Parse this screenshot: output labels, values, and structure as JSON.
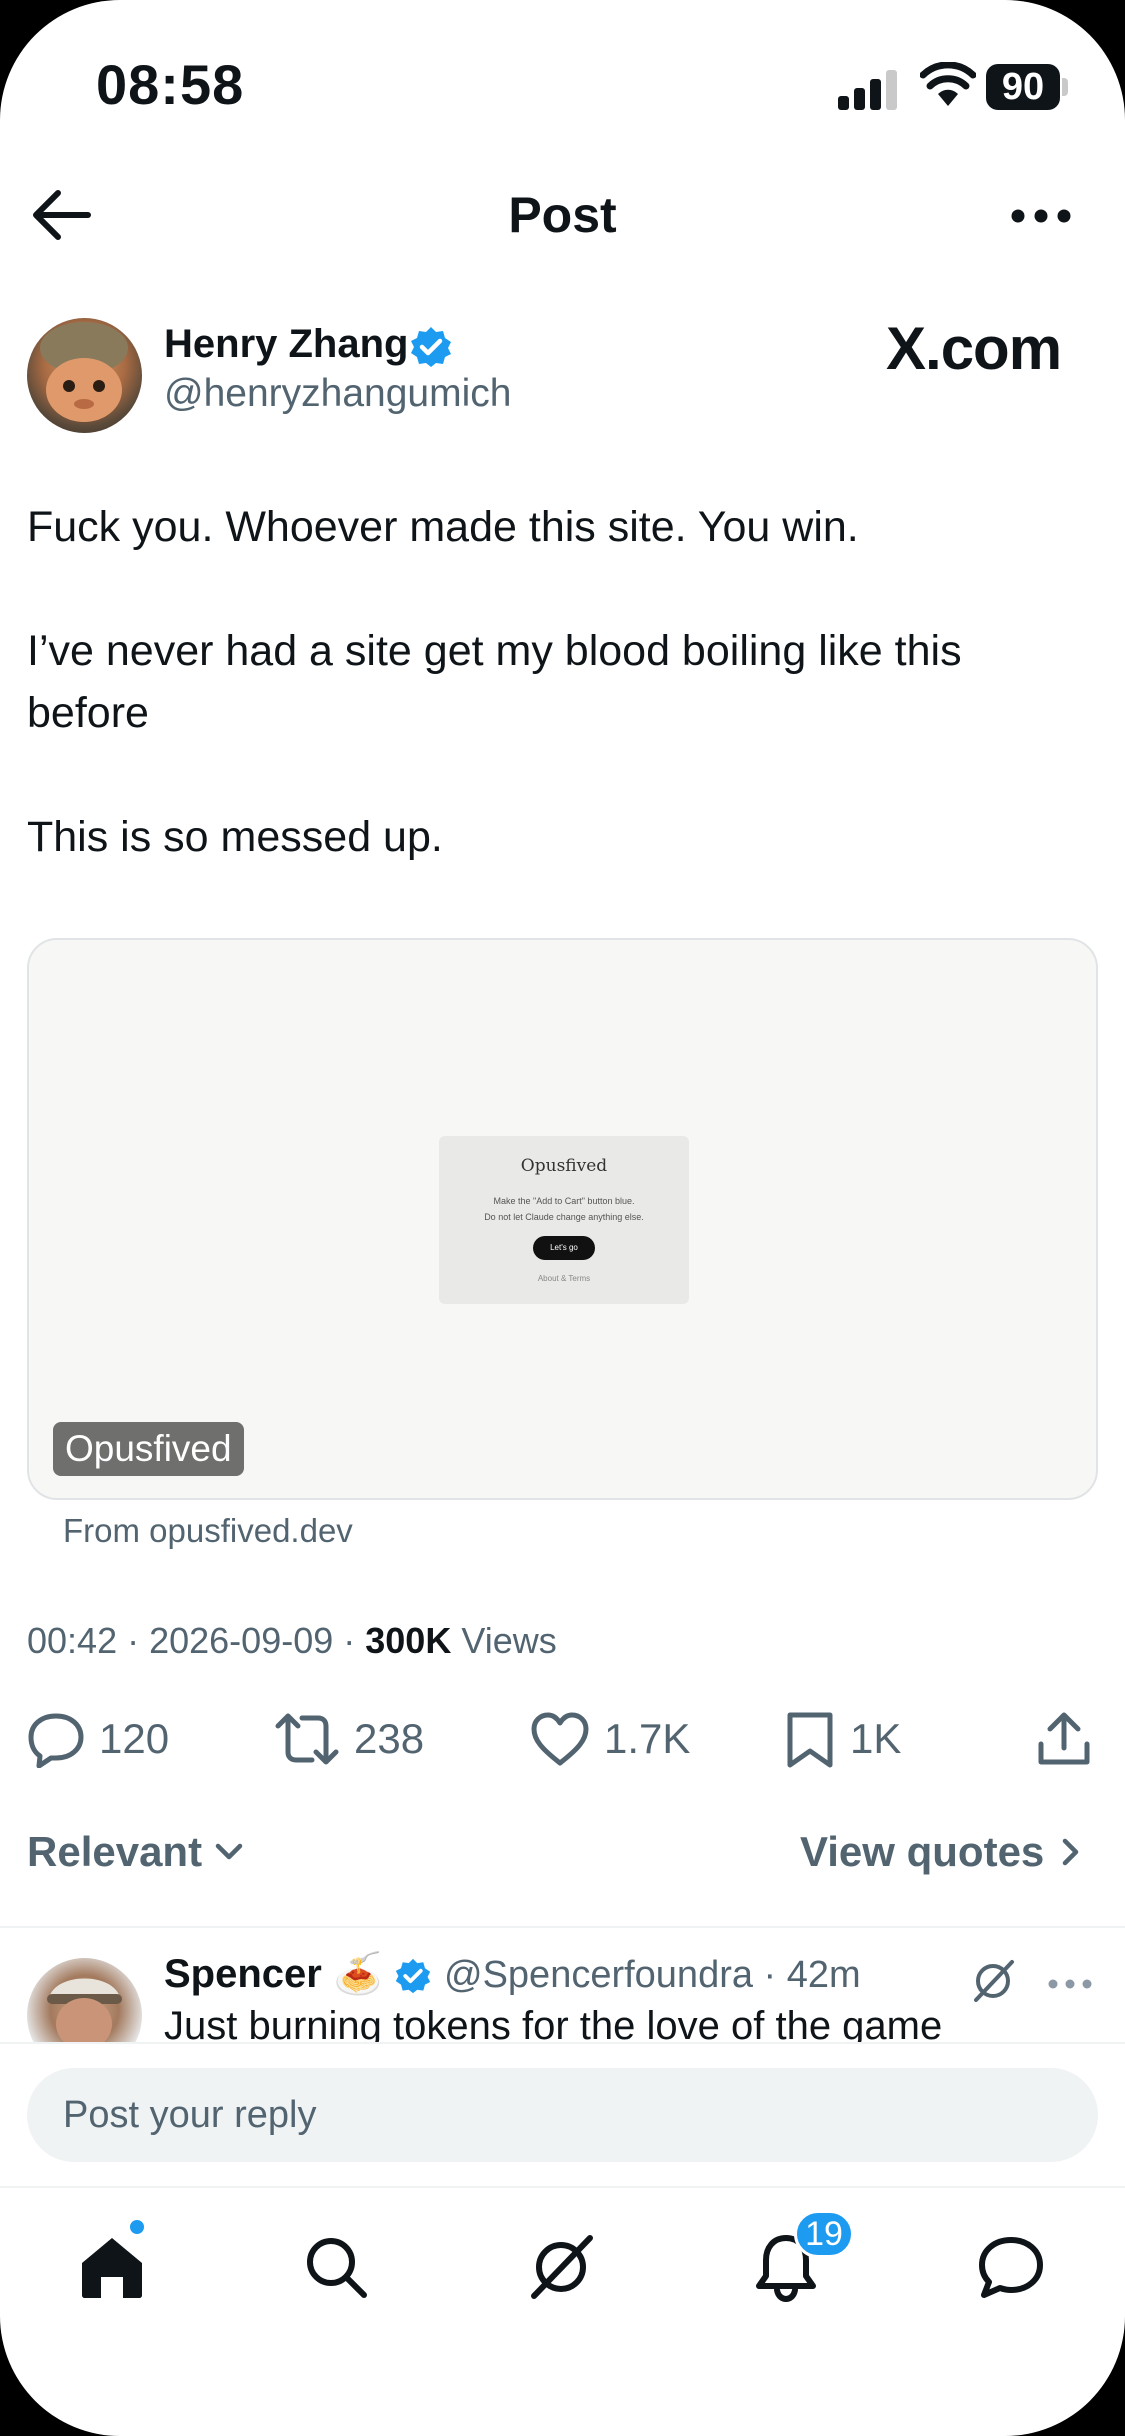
{
  "status_bar": {
    "time": "08:58",
    "battery": "90"
  },
  "header": {
    "title": "Post"
  },
  "author": {
    "name": "Henry Zhang",
    "handle": "@henryzhangumich",
    "site_label": "X.com"
  },
  "post": {
    "paragraphs": [
      "Fuck you. Whoever made this site. You win.",
      "I’ve never had a site get my blood boiling like this before",
      "This is so messed up."
    ]
  },
  "card": {
    "preview": {
      "title": "Opusfived",
      "line1": "Make the \"Add to Cart\" button blue.",
      "line2": "Do not let Claude change anything else.",
      "button": "Let's go",
      "footer": "About & Terms"
    },
    "label": "Opusfived",
    "source": "From opusfived.dev"
  },
  "meta": {
    "time": "00:42",
    "date": "2026-09-09",
    "views_count": "300K",
    "views_label": "Views"
  },
  "actions": {
    "replies": "120",
    "reposts": "238",
    "likes": "1.7K",
    "bookmarks": "1K"
  },
  "sort": {
    "relevant": "Relevant",
    "view_quotes": "View quotes"
  },
  "reply_preview": {
    "name": "Spencer",
    "emoji": "🍝",
    "handle_time": "@Spencerfoundra · 42m",
    "text": "Just burning tokens for the love of the game"
  },
  "reply_box": {
    "placeholder": "Post your reply"
  },
  "tab_bar": {
    "notifications_badge": "19"
  },
  "colors": {
    "accent": "#1d9bf0",
    "text": "#0f1419",
    "secondary": "#536471"
  }
}
